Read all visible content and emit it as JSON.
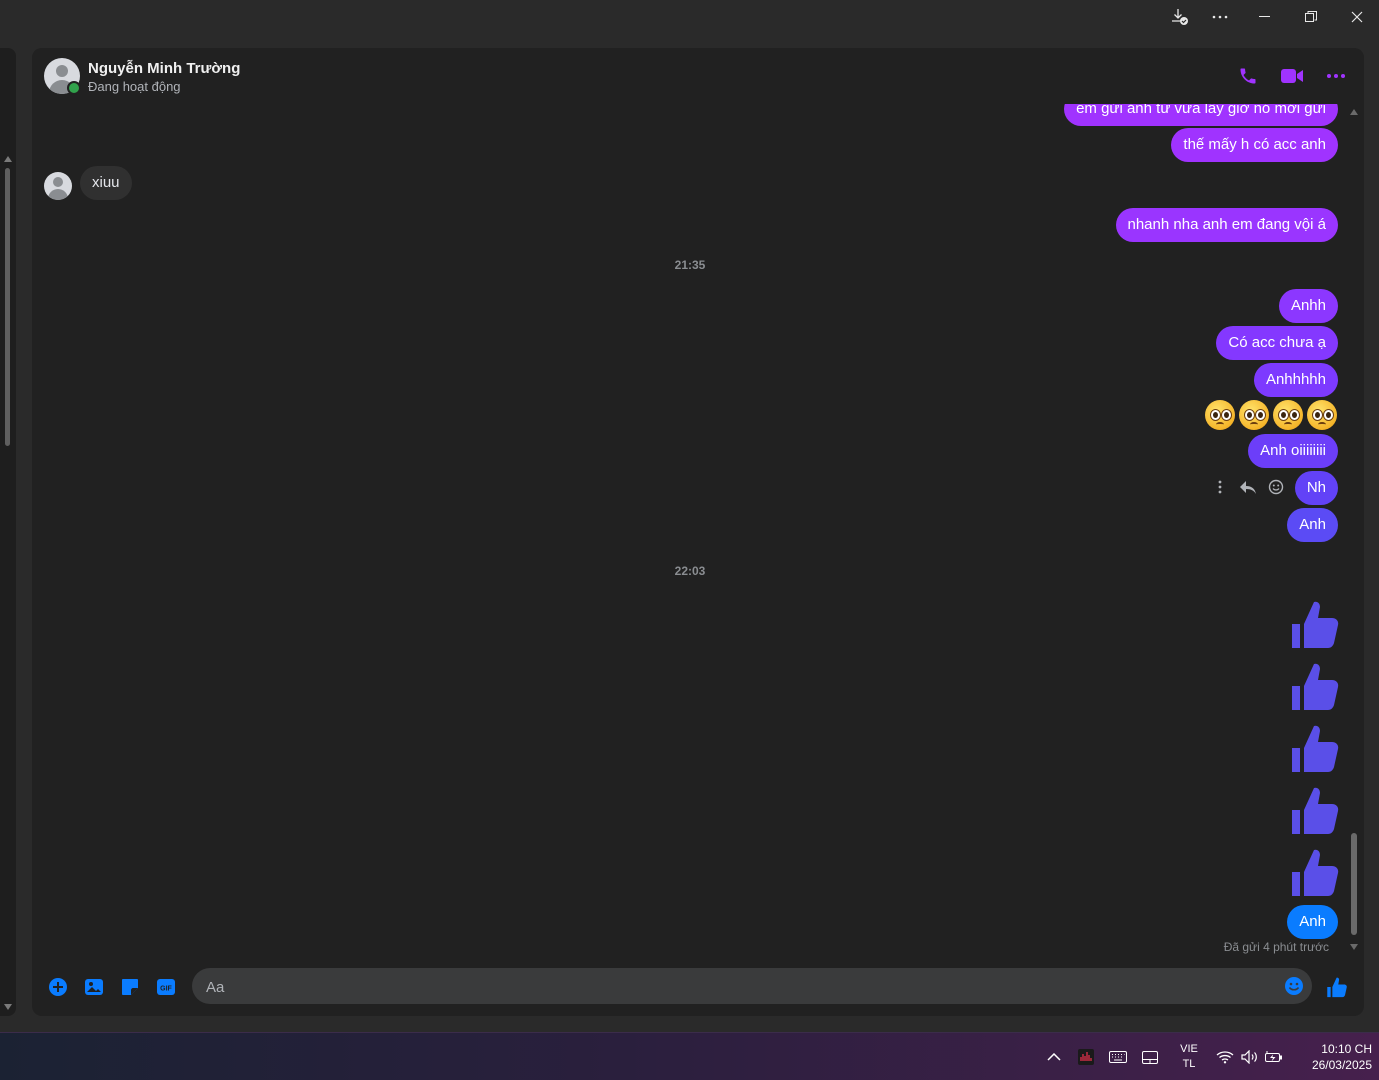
{
  "window": {
    "download_icon": "download-check-icon",
    "more_icon": "more-horizontal-icon",
    "minimize_icon": "minimize-icon",
    "restore_icon": "restore-icon",
    "close_icon": "close-icon"
  },
  "header": {
    "name": "Nguyễn Minh Trường",
    "status": "Đang hoạt động",
    "accent": "#a033ff"
  },
  "messages": {
    "m1": "em gửi ảnh từ vừa lấy giờ nó mới gửi",
    "m2": "thế mấy h có acc anh",
    "r1": "xiuu",
    "m3": "nhanh nha anh em đang vội á",
    "t1": "21:35",
    "m4": "Anhh",
    "m5": "Có acc chưa ạ",
    "m6": "Anhhhhh",
    "emoji": "pleading-face",
    "m7": "Anh oiiiiiiii",
    "m8": "Nh",
    "m9": "Anh",
    "t2": "22:03",
    "thumbs_count": 5,
    "m10": "Anh",
    "sent": "Đã gửi 4 phút trước"
  },
  "composer": {
    "placeholder": "Aa"
  },
  "taskbar": {
    "lang_top": "VIE",
    "lang_bottom": "TL",
    "time": "10:10 CH",
    "date": "26/03/2025"
  },
  "colors": {
    "bubble_purple_top": "#a033ff",
    "bubble_violet": "#7c3bff",
    "bubble_indigo": "#5b4bf5",
    "bubble_blue": "#0a7cff",
    "thumb": "#5a4fe8"
  }
}
